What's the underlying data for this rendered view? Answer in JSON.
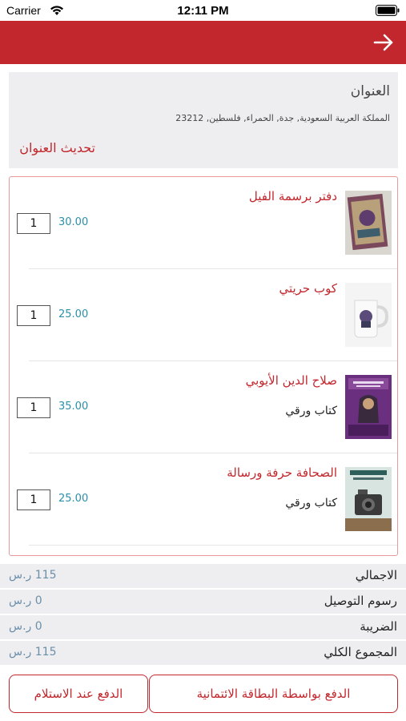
{
  "status_bar": {
    "carrier": "Carrier",
    "time": "12:11 PM"
  },
  "colors": {
    "brand": "#c1272d",
    "price": "#2a8fa8",
    "total_value": "#6b8fa8",
    "card_bg": "#eeeef0"
  },
  "header": {
    "back_icon": "arrow-right-icon"
  },
  "address": {
    "title": "العنوان",
    "text": "المملكة العربية السعودية, جدة, الحمراء, فلسطين, 23212",
    "update_label": "تحديث العنوان"
  },
  "products": [
    {
      "name": "دفتر برسمة الفيل",
      "subtitle": "",
      "price": "30.00",
      "quantity": "1",
      "thumb_icon": "notebook-cover-image"
    },
    {
      "name": "كوب حريتي",
      "subtitle": "",
      "price": "25.00",
      "quantity": "1",
      "thumb_icon": "mug-image"
    },
    {
      "name": "صلاح الدين الأيوبي",
      "subtitle": "كتاب ورقي",
      "price": "35.00",
      "quantity": "1",
      "thumb_icon": "book-cover-image"
    },
    {
      "name": "الصحافة حرفة ورسالة",
      "subtitle": "كتاب ورقي",
      "price": "25.00",
      "quantity": "1",
      "thumb_icon": "book-cover-image"
    }
  ],
  "totals": [
    {
      "label": "الاجمالي",
      "value": "115 ر.س"
    },
    {
      "label": "رسوم التوصيل",
      "value": "0 ر.س"
    },
    {
      "label": "الضريبة",
      "value": "0 ر.س"
    },
    {
      "label": "المجموع الكلي",
      "value": "115 ر.س"
    }
  ],
  "buttons": {
    "pay_card": "الدفع بواسطة البطاقة الائتمانية",
    "pay_cod": "الدفع عند الاستلام"
  }
}
